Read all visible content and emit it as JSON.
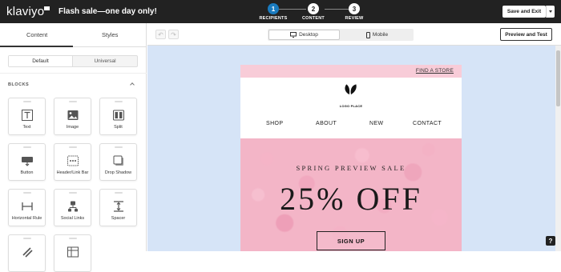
{
  "topbar": {
    "brand": "klaviyo",
    "campaign_title": "Flash sale—one day only!",
    "steps": [
      {
        "number": "1",
        "label": "RECIPIENTS",
        "active": true
      },
      {
        "number": "2",
        "label": "CONTENT",
        "active": false
      },
      {
        "number": "3",
        "label": "REVIEW",
        "active": false
      }
    ],
    "save_exit_label": "Save and Exit"
  },
  "sidebar": {
    "tabs": [
      "Content",
      "Styles"
    ],
    "segments": [
      "Default",
      "Universal"
    ],
    "blocks_heading": "BLOCKS",
    "blocks": [
      {
        "label": "Text",
        "icon": "text-icon"
      },
      {
        "label": "Image",
        "icon": "image-icon"
      },
      {
        "label": "Split",
        "icon": "split-icon"
      },
      {
        "label": "Button",
        "icon": "button-icon"
      },
      {
        "label": "Header/Link Bar",
        "icon": "header-link-bar-icon"
      },
      {
        "label": "Drop Shadow",
        "icon": "drop-shadow-icon"
      },
      {
        "label": "Horizontal Rule",
        "icon": "horizontal-rule-icon"
      },
      {
        "label": "Social Links",
        "icon": "social-links-icon"
      },
      {
        "label": "Spacer",
        "icon": "spacer-icon"
      }
    ]
  },
  "toolbar": {
    "devices": [
      "Desktop",
      "Mobile"
    ],
    "preview_label": "Preview and Test",
    "help_label": "?"
  },
  "email": {
    "find_store": "FIND A STORE",
    "logo_text": "LOGO PLACE",
    "nav": [
      "SHOP",
      "ABOUT",
      "NEW",
      "CONTACT"
    ],
    "hero_subtitle": "SPRING PREVIEW SALE",
    "hero_title": "25% OFF",
    "cta_label": "SIGN UP"
  },
  "colors": {
    "topbar_bg": "#222222",
    "step_active": "#1a7bbf",
    "canvas_bg": "#d6e4f7",
    "email_top_bar": "#f8ccd8",
    "hero_pink": "#efa6bb"
  }
}
